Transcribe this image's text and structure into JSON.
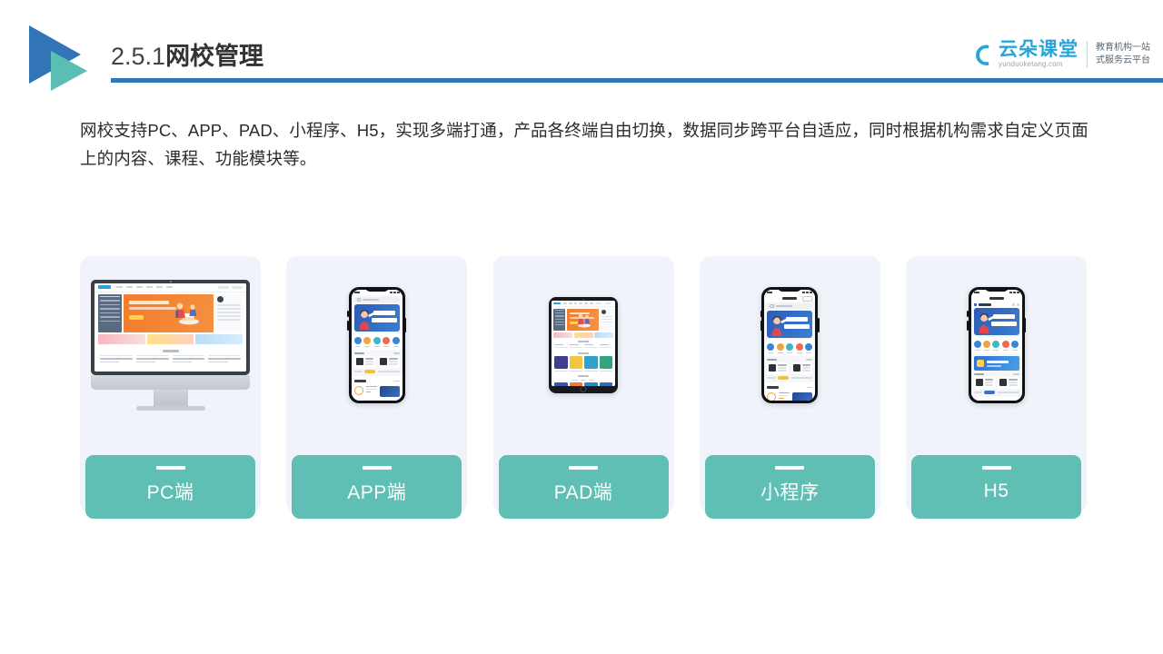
{
  "header": {
    "section_number": "2.5.1",
    "title_zh": "网校管理",
    "logo_icon": "double-triangle-logo",
    "rule_color": "#3276b8"
  },
  "brand": {
    "cloud_icon": "cloud-icon",
    "name": "云朵课堂",
    "url": "yunduoketang.com",
    "tagline_line1": "教育机构一站",
    "tagline_line2": "式服务云平台",
    "accent_color": "#29a3d8"
  },
  "body": {
    "paragraph": "网校支持PC、APP、PAD、小程序、H5，实现多端打通，产品各终端自由切换，数据同步跨平台自适应，同时根据机构需求自定义页面上的内容、课程、功能模块等。"
  },
  "cards": {
    "accent_color": "#5fbfb4",
    "background_color": "#f0f3f9",
    "items": [
      {
        "label": "PC端",
        "device": "desktop-monitor-icon"
      },
      {
        "label": "APP端",
        "device": "smartphone-icon"
      },
      {
        "label": "PAD端",
        "device": "tablet-icon"
      },
      {
        "label": "小程序",
        "device": "smartphone-icon"
      },
      {
        "label": "H5",
        "device": "smartphone-icon"
      }
    ]
  }
}
